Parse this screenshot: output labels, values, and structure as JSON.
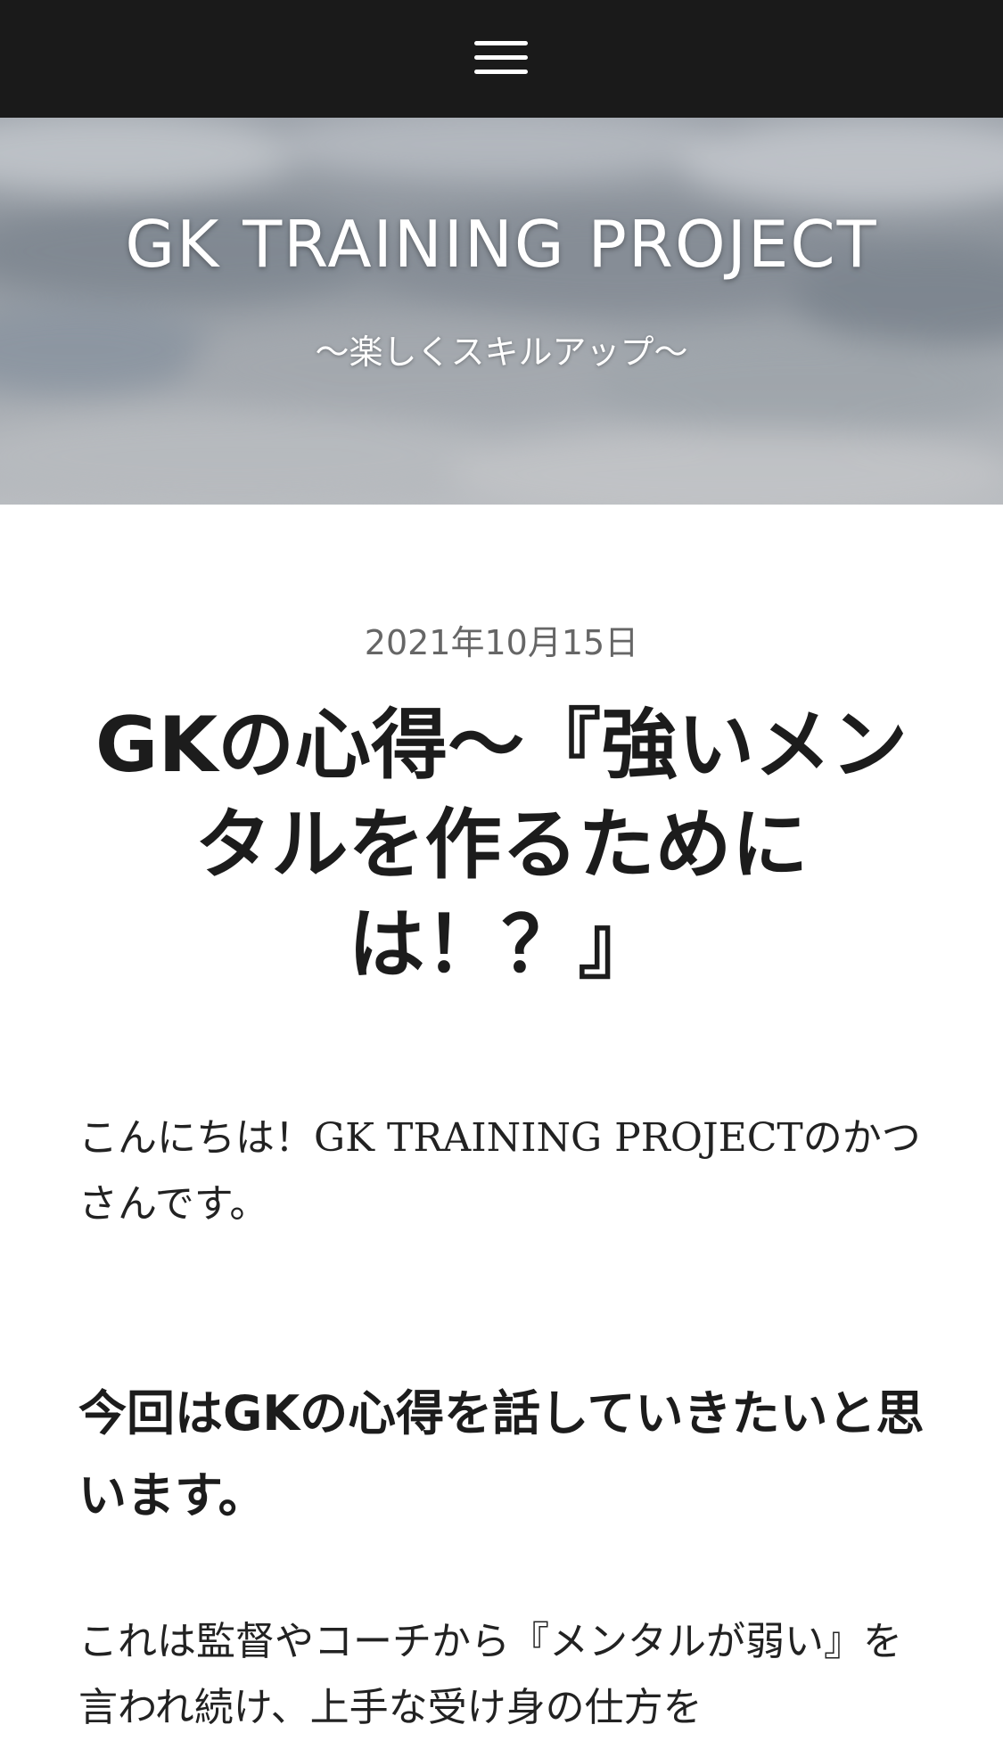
{
  "nav": {
    "menu_icon": "hamburger-menu-icon"
  },
  "header": {
    "site_title": "GK TRAINING PROJECT",
    "tagline": "〜楽しくスキルアップ〜",
    "background": "cloudy-sky"
  },
  "post": {
    "date": "2021年10月15日",
    "title": "GKの心得〜『強いメンタルを作るためには！？』",
    "intro": "こんにちは！GK TRAINING PROJECTのかつさんです。",
    "subheading": "今回はGKの心得を話していきたいと思います。",
    "body": "これは監督やコーチから『メンタルが弱い』を言われ続け、上手な受け身の仕方を"
  },
  "colors": {
    "topbar": "#1a1a1a",
    "title_text": "#1c1c1c",
    "date_text": "#666666",
    "hero_text": "#ffffff"
  }
}
